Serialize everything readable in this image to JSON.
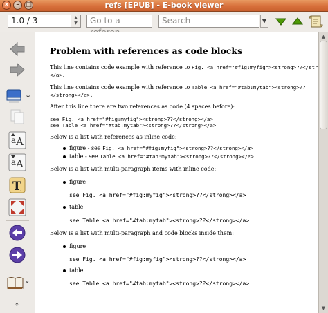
{
  "window": {
    "title": "refs [EPUB] - E-book viewer",
    "controls": [
      "×",
      "–",
      "□"
    ]
  },
  "toolbar": {
    "page_value": "1.0 / 3",
    "goto_placeholder": "Go to a referen…",
    "search_placeholder": "Search",
    "search_down_icon": "arrow-down-icon",
    "search_up_icon": "arrow-up-icon",
    "preferences_icon": "scroll-icon",
    "accent_green": "#4e9a06"
  },
  "sidebar": {
    "icons": [
      "back-icon",
      "forward-icon",
      "library-icon",
      "copy-icon",
      "font-size-larger-icon",
      "font-size-smaller-icon",
      "toggle-font-icon",
      "fullscreen-icon",
      "previous-icon",
      "next-icon",
      "table-of-contents-icon",
      "more-icon"
    ],
    "accent_purple": "#5c3fa8",
    "dropdown_glyph": "⌄",
    "more_glyph": "»"
  },
  "document": {
    "heading": "Problem with references as code blocks",
    "p1_text": "This line contains code example with reference to ",
    "p1_code": "Fig. <a href=\"#fig:myfig\"><strong>??</strong>",
    "p1_code2": "</a>.",
    "p2_text": "This line contains code example with reference to ",
    "p2_code": "Table <a href=\"#tab:mytab\"><strong>??",
    "p2_code2": "</strong></a>.",
    "p3": "After this line there are two references as code (4 spaces before):",
    "code_block1": [
      "see Fig. <a href=\"#fig:myfig\"><strong>??</strong></a>",
      "see Table <a href=\"#tab:mytab\"><strong>??</strong></a>"
    ],
    "p4": "Below is a list with references as inline code:",
    "list1": [
      {
        "text": "figure - see ",
        "code": "Fig. <a href=\"#fig:myfig\"><strong>??</strong></a>"
      },
      {
        "text": "table - see ",
        "code": "Table <a href=\"#tab:mytab\"><strong>??</strong></a>"
      }
    ],
    "p5": "Below is a list with multi-paragraph items with inline code:",
    "list2_item1": "figure",
    "list2_item1_para": "see Fig. <a href=\"#fig:myfig\"><strong>??</strong></a>",
    "list2_item2": "table",
    "list2_item2_para": "see Table <a href=\"#tab:mytab\"><strong>??</strong></a>",
    "p6": "Below is a list with multi-paragraph and code blocks inside them:",
    "list3_item1": "figure",
    "list3_item1_code": "see Fig. <a href=\"#fig:myfig\"><strong>??</strong></a>",
    "list3_item2": "table",
    "list3_item2_code": "see Table <a href=\"#tab:mytab\"><strong>??</strong></a>"
  },
  "scrollbar": {
    "up_glyph": "▲",
    "down_glyph": "▼"
  }
}
